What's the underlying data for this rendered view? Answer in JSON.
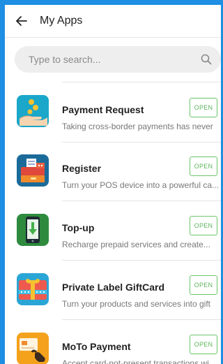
{
  "header": {
    "title": "My Apps"
  },
  "search": {
    "placeholder": "Type to search..."
  },
  "apps": [
    {
      "name": "Payment Request",
      "description": "Taking cross-border payments has never",
      "action": "OPEN"
    },
    {
      "name": "Register",
      "description": "Turn your POS device into a powerful ca...",
      "action": "OPEN"
    },
    {
      "name": "Top-up",
      "description": "Recharge prepaid services and create...",
      "action": "OPEN"
    },
    {
      "name": "Private Label GiftCard",
      "description": "Turn your products and services into gift",
      "action": "OPEN"
    },
    {
      "name": "MoTo Payment",
      "description": "Accept card-not-present transactions wi",
      "action": "OPEN"
    }
  ],
  "icons": {
    "back": "arrow-left-icon",
    "search": "search-icon",
    "apps": [
      "payment-request-icon",
      "register-icon",
      "top-up-icon",
      "gift-card-icon",
      "moto-payment-icon"
    ]
  },
  "colors": {
    "frame": "#1e8fe3",
    "accent": "#5db45b",
    "payment_request": "#1aa7c9",
    "register": "#1b6b9a",
    "top_up": "#2e8b3e",
    "gift_card": "#2aa6d6",
    "moto": "#f4a21c"
  }
}
